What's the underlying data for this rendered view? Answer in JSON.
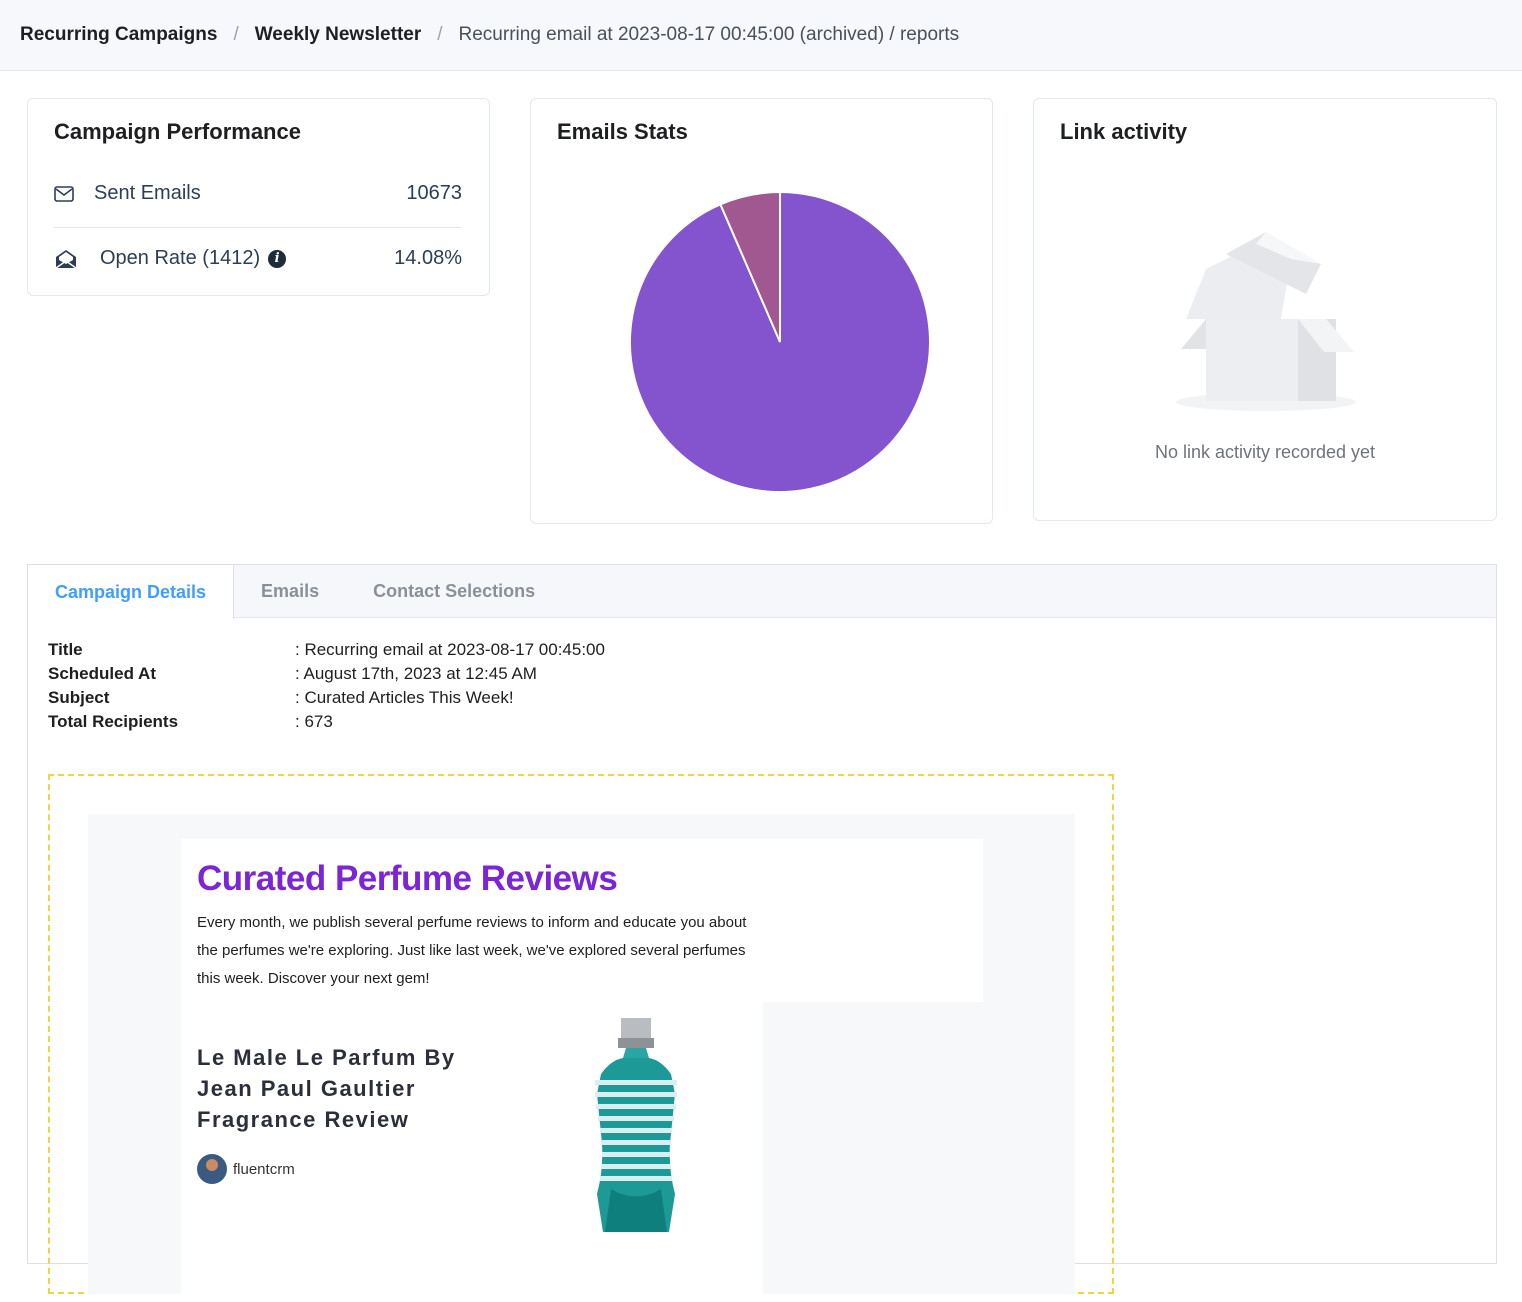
{
  "breadcrumb": {
    "item1": "Recurring Campaigns",
    "item2": "Weekly Newsletter",
    "current": "Recurring email at 2023-08-17 00:45:00 (archived) / reports",
    "separator": "/"
  },
  "performance": {
    "title": "Campaign Performance",
    "sent_label": "Sent Emails",
    "sent_value": "10673",
    "open_label": "Open Rate (1412)",
    "open_value": "14.08%",
    "info_icon": "i"
  },
  "stats": {
    "title": "Emails Stats",
    "chart_data": {
      "type": "pie",
      "title": "Emails Stats",
      "slices": [
        {
          "value": 93.5,
          "color": "#8354ce"
        },
        {
          "value": 6.5,
          "color": "#a1578f"
        }
      ]
    }
  },
  "links": {
    "title": "Link activity",
    "empty_text": "No link activity recorded yet"
  },
  "tabs": [
    "Campaign Details",
    "Emails",
    "Contact Selections"
  ],
  "details": {
    "title_label": "Title",
    "title_value": ": Recurring email at 2023-08-17 00:45:00",
    "scheduled_label": "Scheduled At",
    "scheduled_value": ": August 17th, 2023 at 12:45 AM",
    "subject_label": "Subject",
    "subject_value": ": Curated Articles This Week!",
    "recipients_label": "Total Recipients",
    "recipients_value": ": 673"
  },
  "email": {
    "heading": "Curated Perfume Reviews",
    "intro": "Every month, we publish several perfume reviews to inform and educate you about the perfumes we're exploring. Just like last week, we've explored several perfumes this week. Discover your next gem!",
    "article_title": "Le Male Le Parfum By Jean Paul Gaultier Fragrance Review",
    "author": "fluentcrm"
  }
}
